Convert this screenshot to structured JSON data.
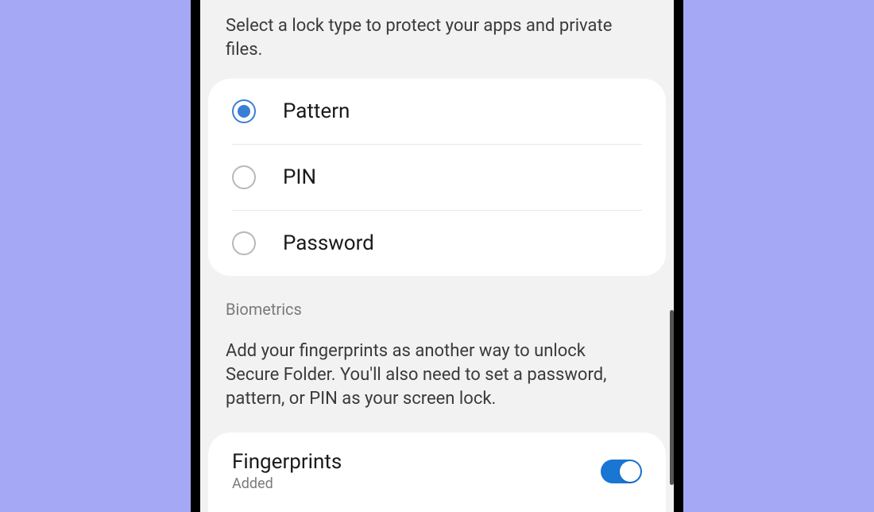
{
  "intro": "Select a lock type to protect your apps and private files.",
  "lockTypes": {
    "pattern": {
      "label": "Pattern",
      "selected": true
    },
    "pin": {
      "label": "PIN",
      "selected": false
    },
    "password": {
      "label": "Password",
      "selected": false
    }
  },
  "biometrics": {
    "header": "Biometrics",
    "description": "Add your fingerprints as another way to unlock Secure Folder. You'll also need to set a password, pattern, or PIN as your screen lock.",
    "fingerprints": {
      "title": "Fingerprints",
      "status": "Added",
      "enabled": true
    }
  }
}
